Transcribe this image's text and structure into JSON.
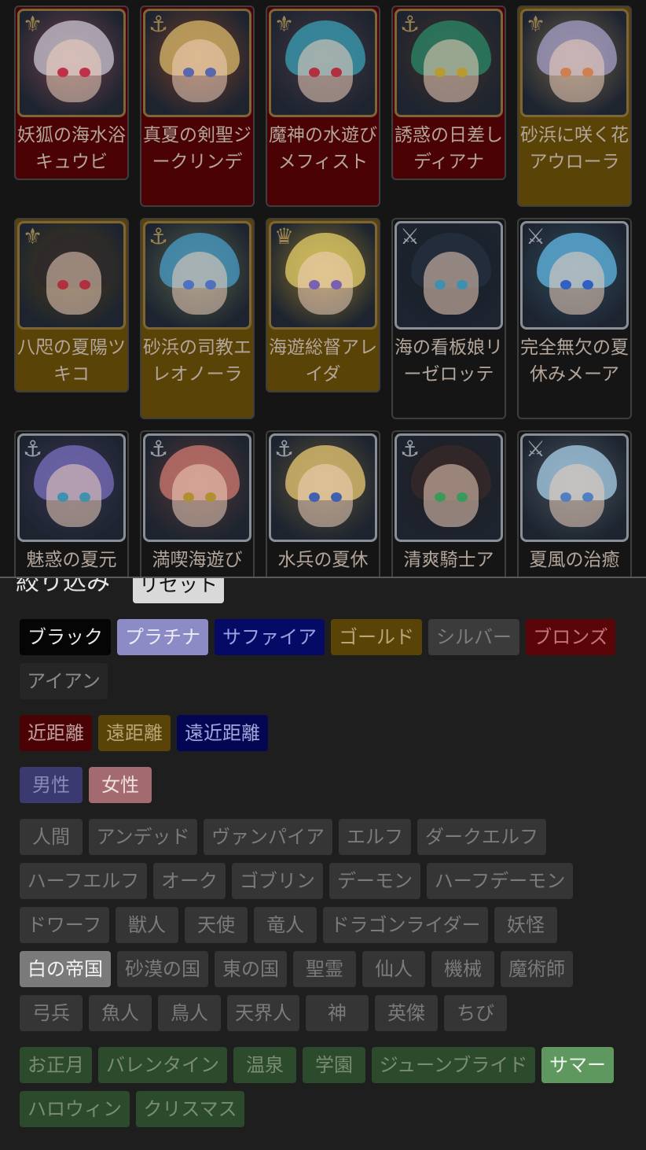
{
  "characters": [
    {
      "name": "妖狐の海水浴キュウビ",
      "rarity": "red",
      "hair": "#c9c6d3",
      "eyes": "#c0304a",
      "crest": "⚜"
    },
    {
      "name": "真夏の剣聖ジークリンデ",
      "rarity": "red",
      "hair": "#d9b86a",
      "eyes": "#5a66b0",
      "crest": "⚓"
    },
    {
      "name": "魔神の水遊びメフィスト",
      "rarity": "red",
      "hair": "#3aa0b7",
      "eyes": "#b03040",
      "crest": "⚜"
    },
    {
      "name": "誘惑の日差しディアナ",
      "rarity": "red",
      "hair": "#2b8a6a",
      "eyes": "#b89a30",
      "crest": "⚓"
    },
    {
      "name": "砂浜に咲く花アウローラ",
      "rarity": "gold",
      "hair": "#a6a0c9",
      "eyes": "#d08050",
      "crest": "⚜"
    },
    {
      "name": "八咫の夏陽ツキコ",
      "rarity": "gold",
      "hair": "#2e2a2e",
      "eyes": "#b03040",
      "crest": "⚜"
    },
    {
      "name": "砂浜の司教エレオノーラ",
      "rarity": "gold",
      "hair": "#4a9cc8",
      "eyes": "#5070c0",
      "crest": "⚓"
    },
    {
      "name": "海遊総督アレイダ",
      "rarity": "gold",
      "hair": "#e6cf6a",
      "eyes": "#7a60b0",
      "crest": "♛"
    },
    {
      "name": "海の看板娘リーゼロッテ",
      "rarity": "silver",
      "hair": "#253040",
      "eyes": "#3f90b0",
      "crest": "⚔"
    },
    {
      "name": "完全無欠の夏休みメーア",
      "rarity": "silver",
      "hair": "#62b8e6",
      "eyes": "#3060c0",
      "crest": "⚔"
    },
    {
      "name": "魅惑の夏元",
      "rarity": "silver",
      "hair": "#7a70c0",
      "eyes": "#4090b0",
      "crest": "⚓"
    },
    {
      "name": "満喫海遊び",
      "rarity": "silver",
      "hair": "#d07a72",
      "eyes": "#b09030",
      "crest": "⚓"
    },
    {
      "name": "水兵の夏休",
      "rarity": "silver",
      "hair": "#e8c874",
      "eyes": "#4060b0",
      "crest": "⚓"
    },
    {
      "name": "清爽騎士ア",
      "rarity": "silver",
      "hair": "#3a2a2a",
      "eyes": "#3a9a5a",
      "crest": "⚓"
    },
    {
      "name": "夏風の治癒",
      "rarity": "silver",
      "hair": "#a8d0ea",
      "eyes": "#5080c0",
      "crest": "⚔"
    }
  ],
  "filter": {
    "title": "絞り込み",
    "reset_label": "リセット",
    "rarity": [
      {
        "label": "ブラック",
        "bg": "#050505",
        "fg": "#e8e8e8"
      },
      {
        "label": "プラチナ",
        "bg": "#8d8bc5",
        "fg": "#ececf6"
      },
      {
        "label": "サファイア",
        "bg": "#050a66",
        "fg": "#9aa2e0"
      },
      {
        "label": "ゴールド",
        "bg": "#5a4307",
        "fg": "#b9a679"
      },
      {
        "label": "シルバー",
        "bg": "#3b3b3b",
        "fg": "#7c7c7c"
      },
      {
        "label": "ブロンズ",
        "bg": "#5a0508",
        "fg": "#c5747b"
      },
      {
        "label": "アイアン",
        "bg": "#262626",
        "fg": "#8a8a8a"
      }
    ],
    "range": [
      {
        "label": "近距離",
        "bg": "#4a0205",
        "fg": "#c0a0a0"
      },
      {
        "label": "遠距離",
        "bg": "#5a4307",
        "fg": "#b9a679"
      },
      {
        "label": "遠近距離",
        "bg": "#030652",
        "fg": "#a0a8dc"
      }
    ],
    "gender": [
      {
        "label": "男性",
        "bg": "#3a3a70",
        "fg": "#8a8ab8"
      },
      {
        "label": "女性",
        "bg": "#a36a70",
        "fg": "#f0e0e0"
      }
    ],
    "race": [
      "人間",
      "アンデッド",
      "ヴァンパイア",
      "エルフ",
      "ダークエルフ",
      "ハーフエルフ",
      "オーク",
      "ゴブリン",
      "デーモン",
      "ハーフデーモン",
      "ドワーフ",
      "獣人",
      "天使",
      "竜人",
      "ドラゴンライダー",
      "妖怪",
      "白の帝国",
      "砂漠の国",
      "東の国",
      "聖霊",
      "仙人",
      "機械",
      "魔術師",
      "弓兵",
      "魚人",
      "鳥人",
      "天界人",
      "神",
      "英傑",
      "ちび"
    ],
    "race_selected": "白の帝国",
    "events": [
      "お正月",
      "バレンタイン",
      "温泉",
      "学園",
      "ジューンブライド",
      "サマー",
      "ハロウィン",
      "クリスマス"
    ],
    "event_selected": "サマー"
  }
}
